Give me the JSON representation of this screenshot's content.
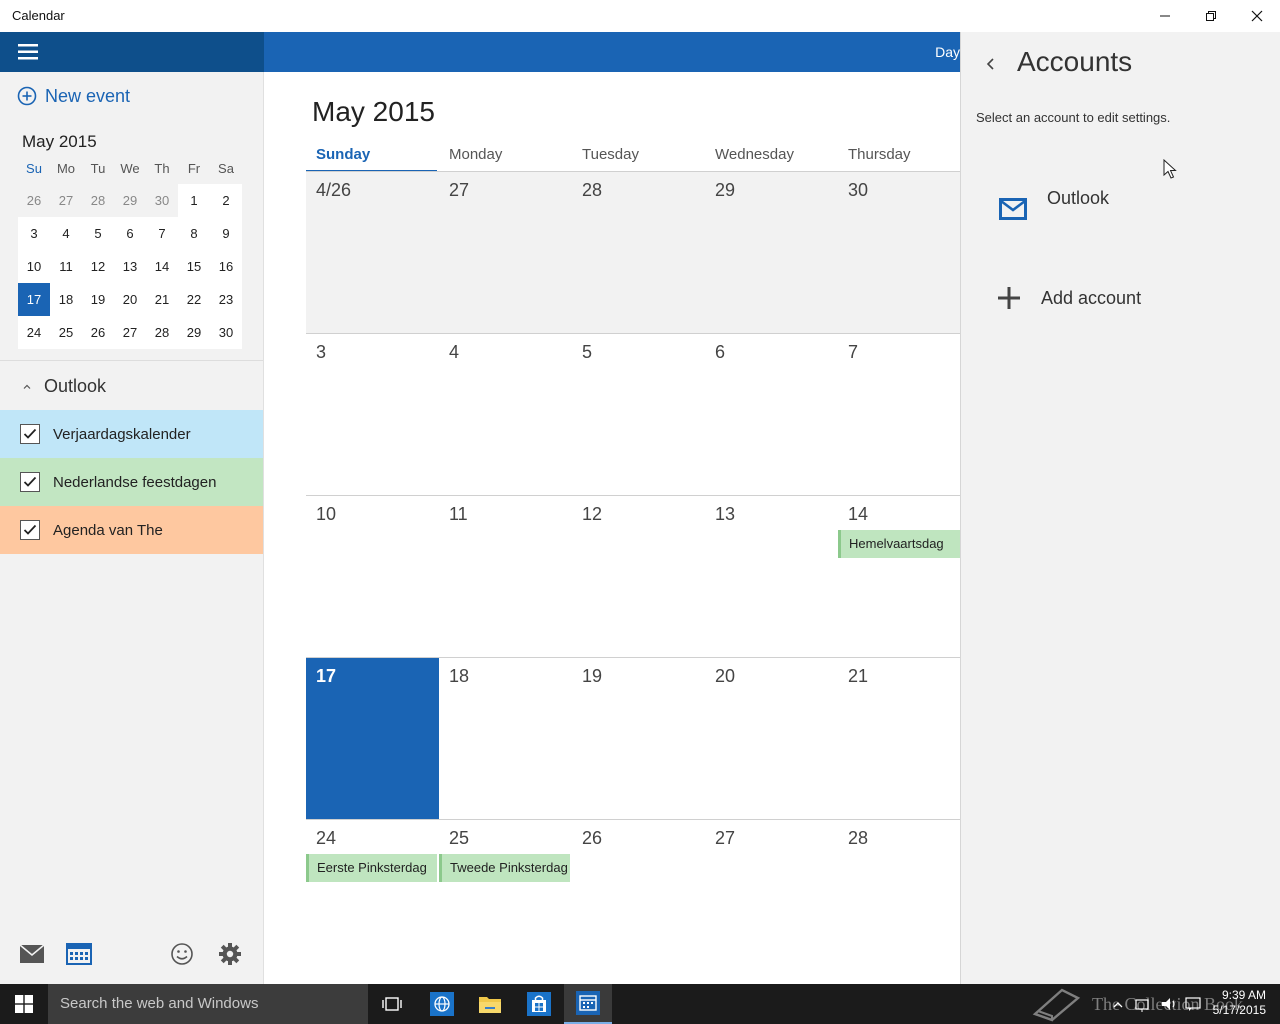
{
  "window": {
    "title": "Calendar"
  },
  "sidebar": {
    "new_event_label": "New event",
    "mini_calendar": {
      "title": "May 2015",
      "weekdays": [
        "Su",
        "Mo",
        "Tu",
        "We",
        "Th",
        "Fr",
        "Sa"
      ],
      "weeks": [
        [
          "26",
          "27",
          "28",
          "29",
          "30",
          "1",
          "2"
        ],
        [
          "3",
          "4",
          "5",
          "6",
          "7",
          "8",
          "9"
        ],
        [
          "10",
          "11",
          "12",
          "13",
          "14",
          "15",
          "16"
        ],
        [
          "17",
          "18",
          "19",
          "20",
          "21",
          "22",
          "23"
        ],
        [
          "24",
          "25",
          "26",
          "27",
          "28",
          "29",
          "30"
        ]
      ],
      "selected": "17"
    },
    "account_section": "Outlook",
    "calendars": [
      {
        "name": "Verjaardagskalender",
        "color": "#c0e6f8",
        "checked": true
      },
      {
        "name": "Nederlandse feestdagen",
        "color": "#c2e6c2",
        "checked": true
      },
      {
        "name": "Agenda van The",
        "color": "#fec8a0",
        "checked": true
      }
    ]
  },
  "toolbar": {
    "view_label": "Day"
  },
  "month_view": {
    "title": "May 2015",
    "weekdays": [
      "Sunday",
      "Monday",
      "Tuesday",
      "Wednesday",
      "Thursday"
    ],
    "weeks": [
      [
        "4/26",
        "27",
        "28",
        "29",
        "30"
      ],
      [
        "3",
        "4",
        "5",
        "6",
        "7"
      ],
      [
        "10",
        "11",
        "12",
        "13",
        "14"
      ],
      [
        "17",
        "18",
        "19",
        "20",
        "21"
      ],
      [
        "24",
        "25",
        "26",
        "27",
        "28"
      ]
    ],
    "events": [
      {
        "title": "Hemelvaartsdag",
        "week": 2,
        "day": 4
      },
      {
        "title": "Eerste Pinksterdag",
        "week": 4,
        "day": 0
      },
      {
        "title": "Tweede Pinksterdag",
        "week": 4,
        "day": 1
      }
    ],
    "today": "17"
  },
  "accounts_panel": {
    "title": "Accounts",
    "description": "Select an account to edit settings.",
    "accounts": [
      {
        "name": "Outlook"
      }
    ],
    "add_account_label": "Add account"
  },
  "taskbar": {
    "search_placeholder": "Search the web and Windows",
    "watermark": "The Collection Book",
    "time": "9:39 AM",
    "date": "5/17/2015"
  },
  "colors": {
    "accent": "#1a64b4",
    "sidebar_header": "#0e4f8b"
  }
}
